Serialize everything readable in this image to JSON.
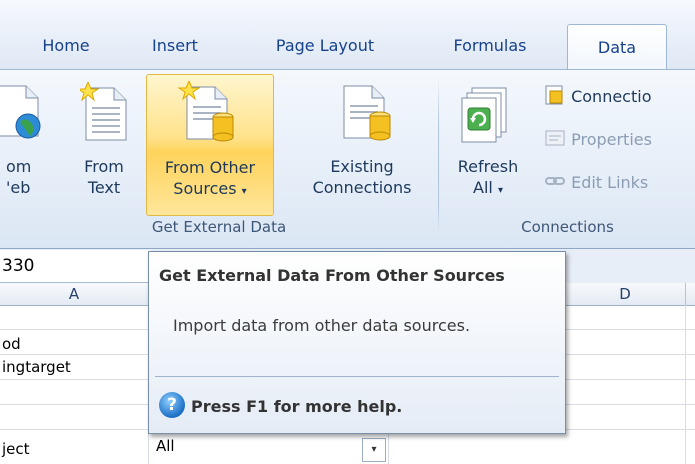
{
  "tabs": [
    {
      "label": "Home"
    },
    {
      "label": "Insert"
    },
    {
      "label": "Page Layout"
    },
    {
      "label": "Formulas"
    },
    {
      "label": "Data"
    }
  ],
  "ribbon": {
    "get_external": {
      "group_label": "Get External Data",
      "web_line1": "om",
      "web_line2": "'eb",
      "text_line1": "From",
      "text_line2": "Text",
      "other_line1": "From Other",
      "other_line2": "Sources",
      "existing_line1": "Existing",
      "existing_line2": "Connections"
    },
    "connections": {
      "group_label": "Connections",
      "refresh_line1": "Refresh",
      "refresh_line2": "All",
      "connections_label": "Connectio",
      "properties_label": "Properties",
      "edit_links_label": "Edit Links"
    },
    "dropdown_arrow": "▾"
  },
  "namebox": {
    "value": "330"
  },
  "columns": [
    "A",
    "D"
  ],
  "cells": {
    "r2_a": "od",
    "r3_a": "ingtarget",
    "r5_a": "ject",
    "r5_b": "All"
  },
  "tooltip": {
    "title": "Get External Data From Other Sources",
    "body": "Import data from other data sources.",
    "help": "Press F1 for more help.",
    "help_glyph": "?"
  },
  "colors": {
    "hover_gold": "#ffd35c",
    "ribbon_blue": "#dbe6f4",
    "tab_text": "#15428b"
  }
}
